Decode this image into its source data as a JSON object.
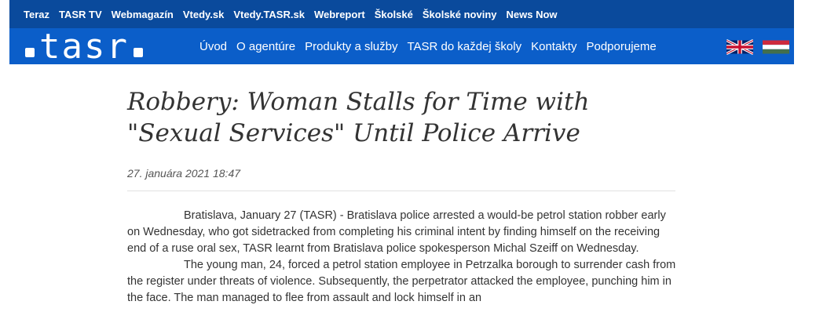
{
  "top_nav": [
    "Teraz",
    "TASR TV",
    "Webmagazín",
    "Vtedy.sk",
    "Vtedy.TASR.sk",
    "Webreport",
    "Školské",
    "Školské noviny",
    "News Now"
  ],
  "logo": {
    "text": "tasr"
  },
  "main_nav": [
    "Úvod",
    "O agentúre",
    "Produkty a služby",
    "TASR do každej školy",
    "Kontakty",
    "Podporujeme"
  ],
  "flags": {
    "left": "uk-flag-icon",
    "right": "hungary-flag-icon"
  },
  "article": {
    "title": "Robbery: Woman Stalls for Time with \"Sexual Services\" Until Police Arrive",
    "date": "27. januára 2021 18:47",
    "paragraphs": [
      "Bratislava, January 27 (TASR) - Bratislava police arrested a would-be petrol station robber early on Wednesday, who got sidetracked from completing his criminal intent by finding himself on the receiving end of a ruse oral sex, TASR learnt from Bratislava police spokesperson Michal Szeiff on Wednesday.",
      "The young man, 24, forced a petrol station employee in Petrzalka borough to surrender cash from the register under threats of violence. Subsequently, the perpetrator attacked the employee, punching him in the face. The man managed to flee from assault and lock himself in an"
    ]
  },
  "colors": {
    "top_bar": "#0a4a9c",
    "main_bar": "#0b5ec9",
    "text": "#333333"
  }
}
